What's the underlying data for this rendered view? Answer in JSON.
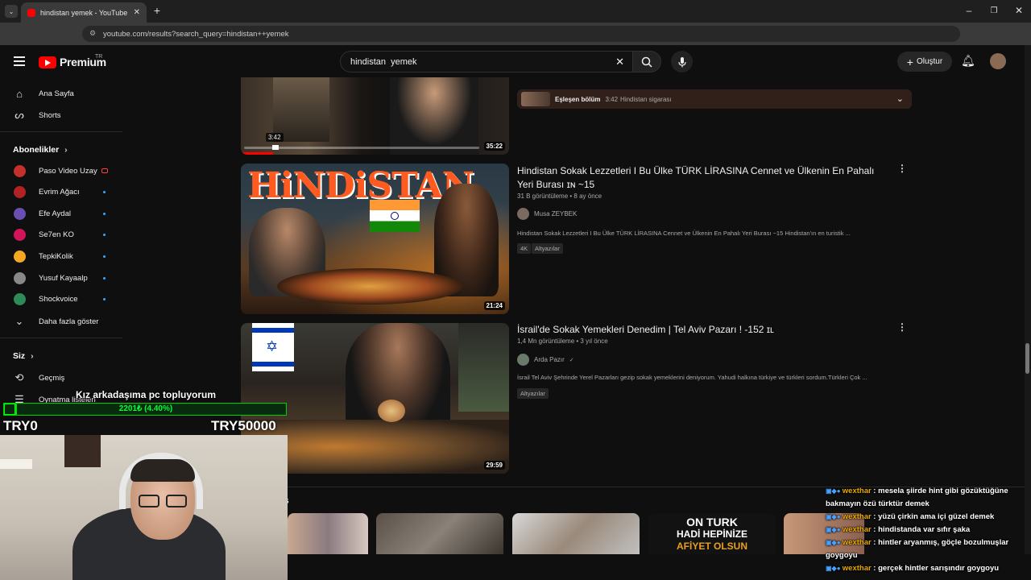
{
  "browser": {
    "tab_title": "hindistan yemek - YouTube",
    "url": "youtube.com/results?search_query=hindistan++yemek"
  },
  "header": {
    "logo_text": "Premium",
    "logo_region": "TR",
    "search_value": "hindistan  yemek",
    "create_label": "Oluştur"
  },
  "sidebar": {
    "home": "Ana Sayfa",
    "shorts": "Shorts",
    "subscriptions_title": "Abonelikler",
    "channels": [
      {
        "name": "Paso Video Uzay",
        "color": "#c4302b",
        "live": true
      },
      {
        "name": "Evrim Ağacı",
        "color": "#b22222",
        "live": false
      },
      {
        "name": "Efe Aydal",
        "color": "#6a4fb3",
        "live": false
      },
      {
        "name": "Se7en KO",
        "color": "#d4145a",
        "live": false
      },
      {
        "name": "TepkiKolik",
        "color": "#f5a623",
        "live": false
      },
      {
        "name": "Yusuf Kayaalp",
        "color": "#888888",
        "live": false
      },
      {
        "name": "Shockvoice",
        "color": "#2e8b57",
        "live": false
      }
    ],
    "show_more": "Daha fazla göster",
    "you_title": "Siz",
    "history": "Geçmiş",
    "playlists": "Oynatma listeleri"
  },
  "videos": [
    {
      "duration": "35:22",
      "progress_time": "3:42",
      "match_label": "Eşleşen bölüm",
      "match_time": "3:42",
      "match_text": "Hindistan sigarası"
    },
    {
      "title": "Hindistan Sokak Lezzetleri I Bu Ülke TÜRK LİRASINA Cennet ve Ülkenin En Pahalı Yeri Burası ɪɴ ~15",
      "meta": "31 B görüntüleme • 8 ay önce",
      "channel": "Musa ZEYBEK",
      "description": "Hindistan Sokak Lezzetleri I Bu Ülke TÜRK LİRASINA Cennet ve Ülkenin En Pahalı Yeri Burası ~15 Hindistan'ın en turistik ...",
      "badges": [
        "4K",
        "Altyazılar"
      ],
      "duration": "21:24",
      "thumb_text": "HiNDiSTAN"
    },
    {
      "title": "İsrail'de Sokak Yemekleri Denedim | Tel Aviv Pazarı ! -152 ɪʟ",
      "meta": "1,4 Mn görüntüleme • 3 yıl önce",
      "channel": "Arda Pazır",
      "verified": "✓",
      "description": "İsrail Tel Aviv Şehrinde Yerel Pazarları gezip sokak yemeklerini deniyorum. Yahudi halkına türkiye ve türkleri sordum.Türkleri Çok ...",
      "badges": [
        "Altyazılar"
      ],
      "duration": "29:59"
    }
  ],
  "shorts_row": {
    "label": "s",
    "thumb4_line1": "ON TURK",
    "thumb4_line2": "HADİ HEPİNİZE",
    "thumb4_line3": "AFİYET OLSUN"
  },
  "stream_overlay": {
    "goal_title": "Kız arkadaşıma pc topluyorum",
    "goal_progress_text": "2201₺ (4.40%)",
    "goal_fraction": 0.044,
    "goal_min": "TRY0",
    "goal_max": "TRY50000"
  },
  "chat": [
    {
      "user": "wexthar",
      "text": "mesela şiirde hint gibi gözüktüğüne bakmayın özü türktür demek"
    },
    {
      "user": "wexthar",
      "text": "yüzü çirkin ama içi güzel demek"
    },
    {
      "user": "wexthar",
      "text": "hindistanda var sıfır şaka"
    },
    {
      "user": "wexthar",
      "text": "hintler aryanmış, göçle bozulmuşlar goygoyu"
    },
    {
      "user": "wexthar",
      "text": "gerçek hintler sarışındır goygoyu"
    }
  ]
}
